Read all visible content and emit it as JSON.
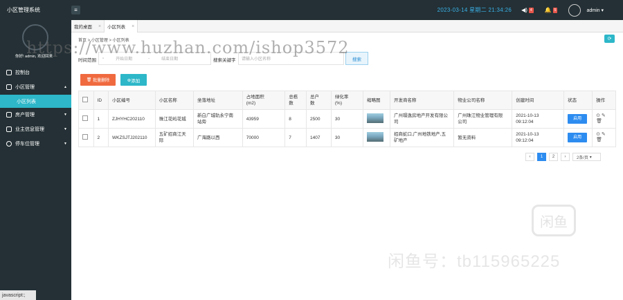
{
  "app": {
    "title": "小区管理系统",
    "menu_icon": "≡"
  },
  "header": {
    "datetime": "2023-03-14  星期二  21:34:26",
    "notify_badge": "4",
    "bell_badge": "5",
    "user": "admin"
  },
  "sidebar": {
    "welcome": "你好! admin, 欢迎回来",
    "items": [
      {
        "label": "控制台"
      },
      {
        "label": "小区管理"
      },
      {
        "label": "小区列表"
      },
      {
        "label": "房产管理"
      },
      {
        "label": "业主信息管理"
      },
      {
        "label": "停车位管理"
      }
    ]
  },
  "status_bar": "javascript:;",
  "tabs": [
    {
      "label": "我的桌面"
    },
    {
      "label": "小区列表"
    }
  ],
  "breadcrumb": "首页  >  小区管理  >  小区列表",
  "filter": {
    "time_label": "时间范围",
    "start_placeholder": "开始日期",
    "sep": "-",
    "end_placeholder": "结束日期",
    "keyword_label": "搜索关键字",
    "keyword_placeholder": "请输入小区名称",
    "search_btn": "搜索"
  },
  "actions": {
    "delete": "批量删除",
    "add": "添加"
  },
  "table": {
    "headers": [
      "ID",
      "小区编号",
      "小区名称",
      "坐落地址",
      "占地面积\n(m2)",
      "总栋\n数",
      "总户\n数",
      "绿化率\n(%)",
      "缩略图",
      "开发商名称",
      "物业公司名称",
      "创建时间",
      "状态",
      "操作"
    ],
    "rows": [
      {
        "id": "1",
        "code": "ZJHYHC202110",
        "name": "珠江花屿花城",
        "address": "新白广城轨永宁南\n站旁",
        "area": "43959",
        "buildings": "8",
        "households": "2500",
        "green": "30",
        "developer": "广州璟逸房地产开发有限公司",
        "property": "广州珠江物业管理有限\n公司",
        "created": "2021-10-13\n09:12:04",
        "status": "启用"
      },
      {
        "id": "2",
        "code": "WKZSJTJ202110",
        "name": "五矿招商江天\n际",
        "address": "广海路以西",
        "area": "70000",
        "buildings": "7",
        "households": "1407",
        "green": "30",
        "developer": "招商蛇口,广州地铁地产,五\n矿地产",
        "property": "暂无资料",
        "created": "2021-10-13\n09:12:04",
        "status": "启用"
      }
    ]
  },
  "pager": {
    "prev": "‹",
    "pages": [
      "1",
      "2"
    ],
    "next": "›",
    "size": "2条/页"
  },
  "watermarks": {
    "url": "https://www.huzhan.com/ishop3572",
    "logo": "闲鱼",
    "text": "闲鱼号：tb115965225"
  }
}
